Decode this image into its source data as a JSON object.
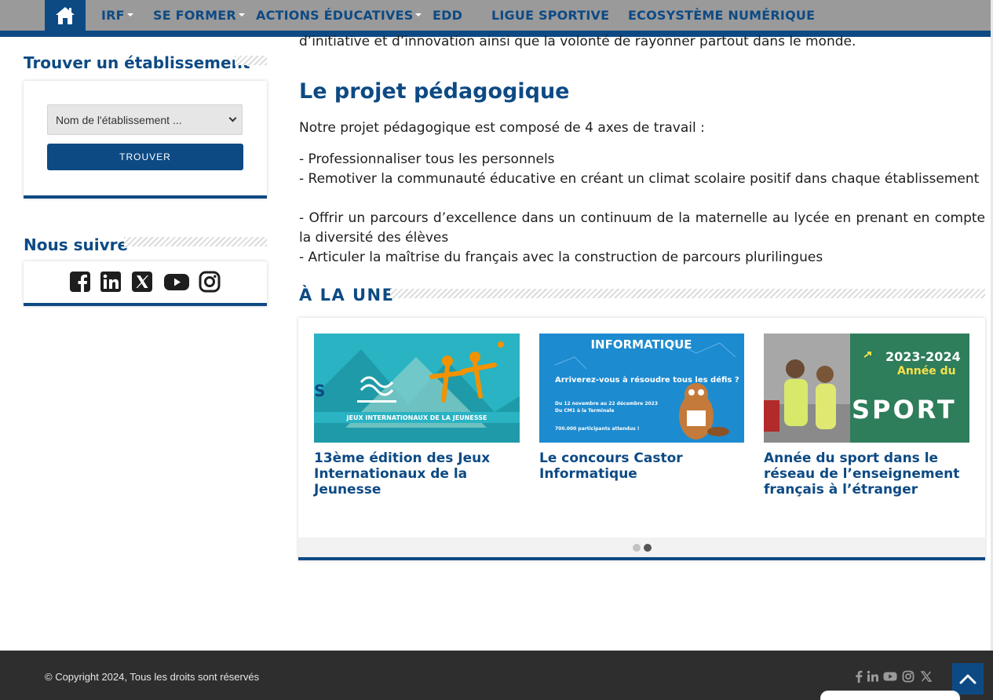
{
  "nav": {
    "items": [
      {
        "label": "IRF",
        "has_dropdown": true
      },
      {
        "label": "SE FORMER",
        "has_dropdown": true
      },
      {
        "label": "ACTIONS ÉDUCATIVES",
        "has_dropdown": true
      },
      {
        "label": "EDD",
        "has_dropdown": false
      },
      {
        "label": "LIGUE SPORTIVE",
        "has_dropdown": false
      },
      {
        "label": "ECOSYSTÈME NUMÉRIQUE",
        "has_dropdown": false
      }
    ],
    "home_icon": "home-icon"
  },
  "sidebar": {
    "find": {
      "title": "Trouver un établissement",
      "select_value": "Nom de l'établissement ...",
      "button_label": "TROUVER"
    },
    "follow": {
      "title": "Nous suivre",
      "icons": [
        "facebook-icon",
        "linkedin-icon",
        "x-icon",
        "youtube-icon",
        "instagram-icon"
      ]
    }
  },
  "main": {
    "intro_tail": "d’initiative et d’innovation ainsi que la volonté de rayonner partout dans le monde.",
    "heading": "Le projet pédagogique",
    "lead": "Notre projet pédagogique est composé de 4 axes de travail :",
    "axes": [
      "- Professionnaliser tous les personnels",
      "- Remotiver la communauté éducative en créant un climat scolaire positif dans chaque établissement",
      "- Offrir un parcours d’excellence dans un continuum de la maternelle au lycée en prenant en compte la diversité des élèves",
      "- Articuler la maîtrise du français avec la construction de parcours plurilingues"
    ],
    "news": {
      "title": "À LA UNE",
      "slides": [
        {
          "caption": "13ème édition des Jeux Internationaux de la Jeunesse",
          "image_text": "JEUX INTERNATIONAUX DE LA JEUNESSE"
        },
        {
          "caption": "Le concours Castor Informatique",
          "image_title": "INFORMATIQUE",
          "image_question": "Arriverez-vous à résoudre tous les défis ?",
          "image_dates": "Du 12 novembre au 22 décembre 2023",
          "image_levels": "Du CM1 à la Terminale",
          "image_participants": "700.000 participants attendus !"
        },
        {
          "caption": "Année du sport dans le réseau de l’enseignement français à l’étranger",
          "image_year": "2023-2024",
          "image_sub": "Année du",
          "image_word": "SPORT"
        }
      ],
      "dots": 2,
      "active_dot": 1
    }
  },
  "footer": {
    "copyright": "© Copyright 2024, Tous les droits sont réservés",
    "icons": [
      "facebook-icon",
      "linkedin-icon",
      "youtube-icon",
      "instagram-icon",
      "x-icon"
    ],
    "back_to_top_icon": "chevron-up-icon"
  },
  "colors": {
    "primary": "#0d4a84",
    "nav_bg": "#9a9a9a",
    "footer_bg": "#2e2e2e",
    "accent_orange": "#f39200"
  }
}
